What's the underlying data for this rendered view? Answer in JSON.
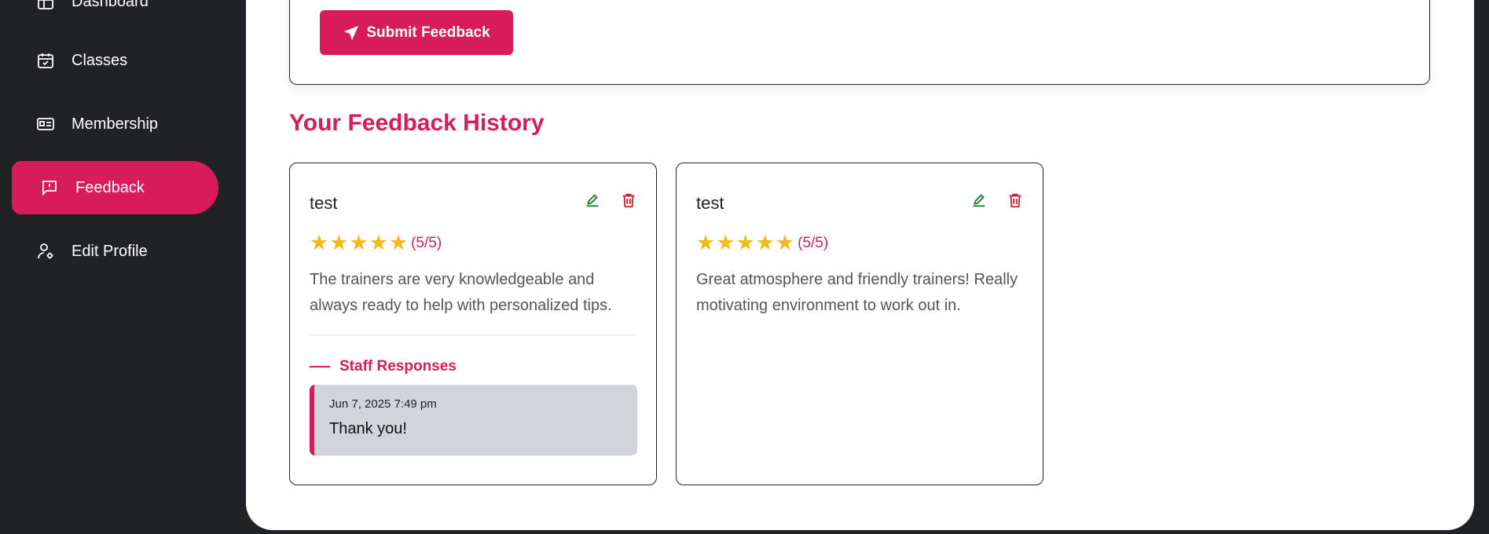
{
  "sidebar": {
    "items": [
      {
        "label": "Dashboard",
        "icon": "dashboard-icon",
        "active": false
      },
      {
        "label": "Classes",
        "icon": "calendar-check-icon",
        "active": false
      },
      {
        "label": "Membership",
        "icon": "id-card-icon",
        "active": false
      },
      {
        "label": "Feedback",
        "icon": "message-alert-icon",
        "active": true
      },
      {
        "label": "Edit Profile",
        "icon": "user-gear-icon",
        "active": false
      }
    ]
  },
  "form": {
    "submit_label": "Submit Feedback"
  },
  "history": {
    "title": "Your Feedback History",
    "cards": [
      {
        "title": "test",
        "stars": 5,
        "rating_text": "(5/5)",
        "comment": "The trainers are very knowledgeable and always ready to help with personalized tips.",
        "staff_heading": "Staff Responses",
        "responses": [
          {
            "date": "Jun 7, 2025 7:49 pm",
            "text": "Thank you!"
          }
        ]
      },
      {
        "title": "test",
        "stars": 5,
        "rating_text": "(5/5)",
        "comment": "Great atmosphere and friendly trainers! Really motivating environment to work out in."
      }
    ]
  },
  "colors": {
    "accent": "#d81b5a",
    "sidebar_bg": "#212226",
    "star": "#f6b916",
    "edit": "#1e7a2f",
    "delete": "#d61c2b"
  }
}
